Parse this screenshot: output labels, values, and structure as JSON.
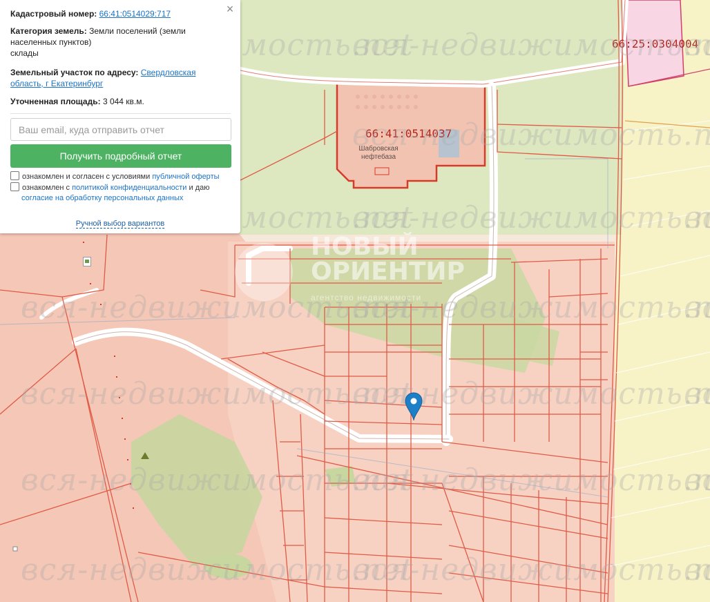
{
  "map": {
    "colors": {
      "background": "#f6e9dc",
      "parcel_fill": "#f7cdbf",
      "parcel_border": "#e05a46",
      "forest": "#c9dcaa",
      "green_zone": "#dde8c0",
      "yellow_zone": "#f7f3c6",
      "pink_zone": "#f8d6e4",
      "road": "#ffffff",
      "pin": "#1e7fc9"
    },
    "plot_labels": [
      {
        "text": "66:41:0514037"
      },
      {
        "text": "66:25:0304004"
      }
    ],
    "poi_labels": [
      {
        "text": "Шабровская\nнефтебаза"
      }
    ],
    "watermark": {
      "text": "вся-недвижимость.net"
    },
    "brand": {
      "title": "НОВЫЙ\nОРИЕНТИР",
      "subtitle": "агентство недвижимости"
    },
    "marker": {
      "icon": "location-pin-icon"
    }
  },
  "panel": {
    "close_icon": "×",
    "cadastral_label": "Кадастровый номер:",
    "cadastral_value": "66:41:0514029:717",
    "category_label": "Категория земель:",
    "category_value": "Земли поселений (земли населенных пунктов)",
    "category_use": "склады",
    "address_label": "Земельный участок по адресу:",
    "address_value": "Свердловская область, г Екатеринбург",
    "area_label": "Уточненная площадь:",
    "area_value": "3 044 кв.м.",
    "email_placeholder": "Ваш email, куда отправить отчет",
    "report_button": "Получить подробный отчет",
    "offer_text": "ознакомлен и согласен с условиями",
    "offer_link": "публичной оферты",
    "privacy_text": "ознакомлен с",
    "privacy_link": "политикой конфиденциальности",
    "privacy_tail": "и даю",
    "consent_link": "согласие на обработку персональных данных",
    "manual_link": "Ручной выбор вариантов"
  }
}
